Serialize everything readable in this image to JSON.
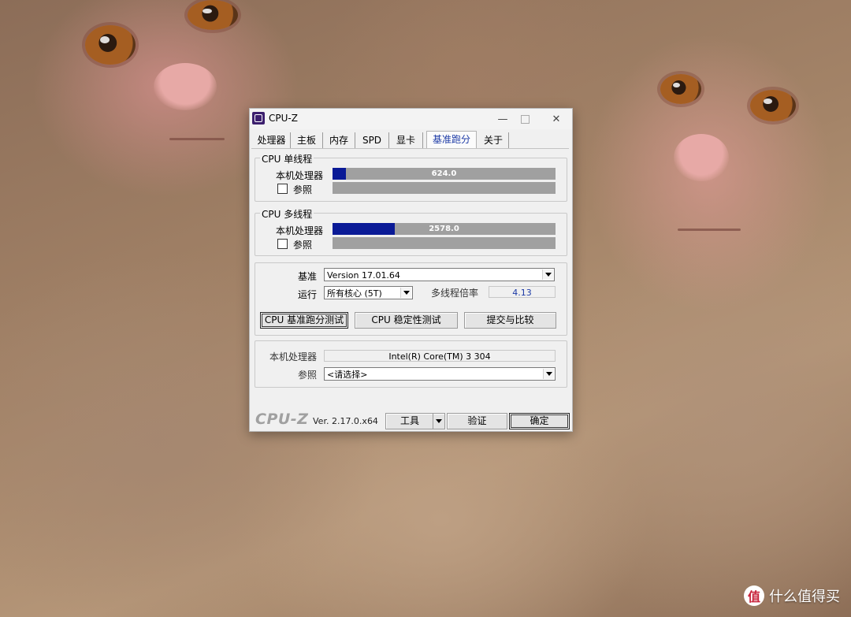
{
  "window": {
    "title": "CPU-Z",
    "tabs": [
      "处理器",
      "主板",
      "内存",
      "SPD",
      "显卡",
      "基准跑分",
      "关于"
    ],
    "active_tab": "基准跑分"
  },
  "single_thread": {
    "group_label": "CPU 单线程",
    "this_processor_label": "本机处理器",
    "this_processor_score": "624.0",
    "this_processor_fraction": 0.06,
    "reference_label": "参照",
    "reference_checked": false
  },
  "multi_thread": {
    "group_label": "CPU 多线程",
    "this_processor_label": "本机处理器",
    "this_processor_score": "2578.0",
    "this_processor_fraction": 0.28,
    "reference_label": "参照",
    "reference_checked": false
  },
  "settings": {
    "benchmark_label": "基准",
    "benchmark_value": "Version 17.01.64",
    "threads_label": "运行",
    "threads_value": "所有核心 (5T)",
    "ratio_label": "多线程倍率",
    "ratio_value": "4.13"
  },
  "buttons": {
    "bench": "CPU 基准跑分测试",
    "stress": "CPU 稳定性测试",
    "submit": "提交与比较"
  },
  "processor_info": {
    "this_label": "本机处理器",
    "this_value": "Intel(R) Core(TM) 3 304",
    "ref_label": "参照",
    "ref_value": "<请选择>"
  },
  "footer": {
    "logo": "CPU-Z",
    "version": "Ver. 2.17.0.x64",
    "tools": "工具",
    "validate": "验证",
    "ok": "确定"
  },
  "watermark": {
    "logo_char": "值",
    "text": "什么值得买"
  },
  "colors": {
    "bar_fill": "#0a1a96",
    "bar_track": "#a0a0a0",
    "active_tab_text": "#1c3aa6"
  }
}
